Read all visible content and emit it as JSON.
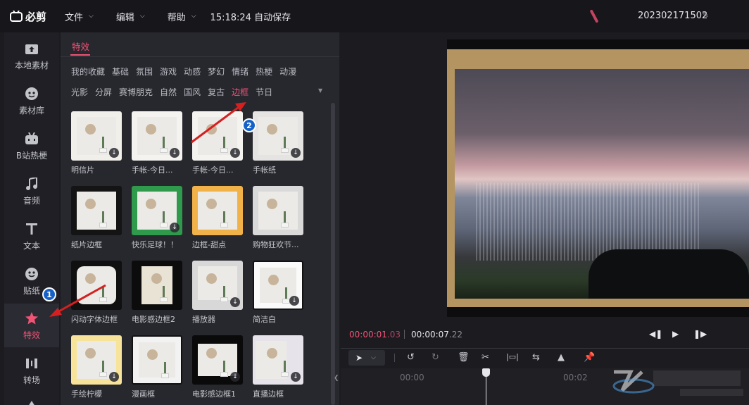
{
  "app": {
    "name": "必剪",
    "project_name": "202302171502",
    "autosave": "15:18:24 自动保存"
  },
  "menu": [
    {
      "label": "文件"
    },
    {
      "label": "编辑"
    },
    {
      "label": "帮助"
    }
  ],
  "sidebar": {
    "items": [
      {
        "label": "本地素材",
        "icon": "upload-folder-icon"
      },
      {
        "label": "素材库",
        "icon": "face-icon"
      },
      {
        "label": "B站热梗",
        "icon": "bilibili-tv-icon"
      },
      {
        "label": "音频",
        "icon": "music-note-icon"
      },
      {
        "label": "文本",
        "icon": "text-t-icon"
      },
      {
        "label": "贴纸",
        "icon": "sticker-icon"
      },
      {
        "label": "特效",
        "icon": "star-effect-icon",
        "active": true
      },
      {
        "label": "转场",
        "icon": "transition-icon"
      }
    ]
  },
  "panel": {
    "title": "特效",
    "categories_row1": [
      "我的收藏",
      "基础",
      "氛围",
      "游戏",
      "动感",
      "梦幻",
      "情绪",
      "热梗",
      "动漫"
    ],
    "categories_row2": [
      "光影",
      "分屏",
      "赛博朋克",
      "自然",
      "国风",
      "复古",
      "边框",
      "节日"
    ],
    "active_category": "边框",
    "effects": [
      {
        "label": "明信片"
      },
      {
        "label": "手帐-今日..."
      },
      {
        "label": "手帐-今日..."
      },
      {
        "label": "手帐纸"
      },
      {
        "label": "纸片边框"
      },
      {
        "label": "快乐足球！！"
      },
      {
        "label": "边框-甜点"
      },
      {
        "label": "购物狂欢节..."
      },
      {
        "label": "闪动字体边框"
      },
      {
        "label": "电影感边框2"
      },
      {
        "label": "播放器"
      },
      {
        "label": "简洁白"
      },
      {
        "label": "手绘柠檬"
      },
      {
        "label": "漫画框"
      },
      {
        "label": "电影感边框1"
      },
      {
        "label": "直播边框"
      }
    ]
  },
  "player": {
    "current_time": "00:00:01",
    "current_frames": ".03",
    "total_time": "00:00:07",
    "total_frames": ".22"
  },
  "timeline": {
    "ruler_labels": [
      "00:00",
      "00:02"
    ]
  },
  "annotations": {
    "badge1": "1",
    "badge2": "2"
  },
  "colors": {
    "accent": "#f05475",
    "badge": "#1561c8",
    "arrow": "#d42020"
  }
}
